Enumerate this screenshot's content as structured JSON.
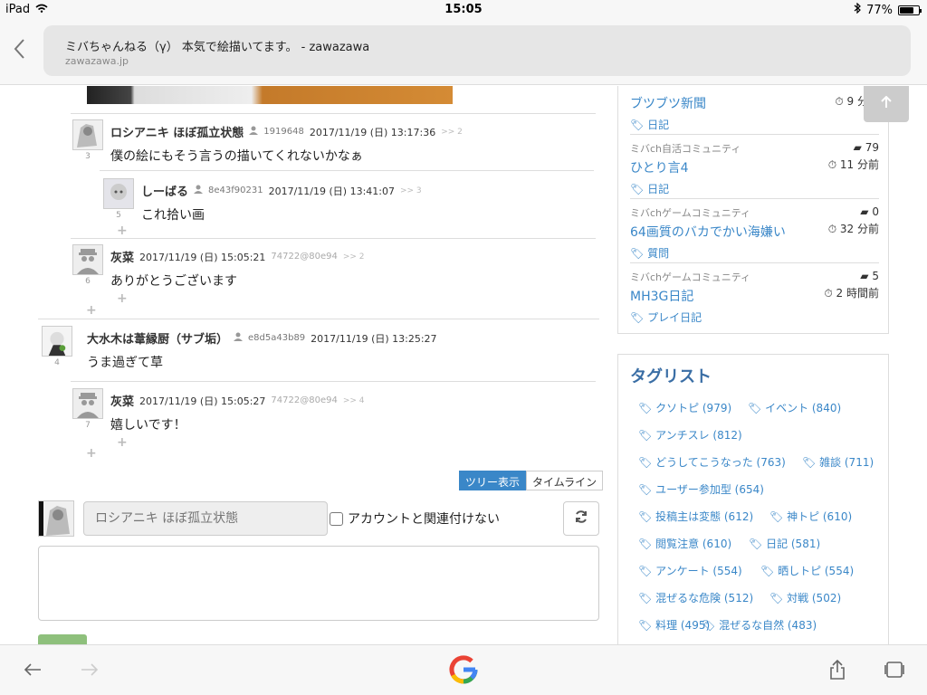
{
  "status": {
    "device": "iPad",
    "time": "15:05",
    "battery": "77%",
    "battery_level": 0.77
  },
  "browser": {
    "title": "ミバちゃんねる（γ） 本気で絵描いてます。 - zawazawa",
    "domain": "zawazawa.jp"
  },
  "comments": [
    {
      "name": "ロシアニキ ほぼ孤立状態",
      "uid": "1919648",
      "date": "2017/11/19 (日) 13:17:36",
      "reply": ">> 2",
      "num": "3",
      "body": "僕の絵にもそう言うの描いてくれないかなぁ"
    },
    {
      "name": "しーばる",
      "uid": "8e43f90231",
      "date": "2017/11/19 (日) 13:41:07",
      "reply": ">> 3",
      "num": "5",
      "body": "これ拾い画"
    },
    {
      "name": "灰菜",
      "uid": "74722@80e94",
      "date": "2017/11/19 (日) 15:05:21",
      "reply": ">> 2",
      "num": "6",
      "body": "ありがとうございます"
    },
    {
      "name": "大水木は葦縁厨（サブ垢）",
      "uid": "e8d5a43b89",
      "date": "2017/11/19 (日) 13:25:27",
      "reply": "",
      "num": "4",
      "body": "うま過ぎて草"
    },
    {
      "name": "灰菜",
      "uid": "74722@80e94",
      "date": "2017/11/19 (日) 15:05:27",
      "reply": ">> 4",
      "num": "7",
      "body": "嬉しいです！"
    }
  ],
  "plus": "+",
  "view": {
    "tree": "ツリー表示",
    "timeline": "タイムライン"
  },
  "form": {
    "name_placeholder": "ロシアニキ ほぼ孤立状態",
    "checkbox_label": "アカウントと関連付けない"
  },
  "trending": [
    {
      "category": "",
      "title": "ブツブツ新聞",
      "tag": "日記",
      "count": "",
      "age": "9 分前"
    },
    {
      "category": "ミバch自活コミュニティ",
      "title": "ひとり言4",
      "tag": "日記",
      "count": "79",
      "age": "11 分前"
    },
    {
      "category": "ミバchゲームコミュニティ",
      "title": "64画質のバカでかい海嫌い",
      "tag": "質問",
      "count": "0",
      "age": "32 分前"
    },
    {
      "category": "ミバchゲームコミュニティ",
      "title": "MH3G日記",
      "tag": "プレイ日記",
      "count": "5",
      "age": "2 時間前"
    }
  ],
  "taglist": {
    "heading": "タグリスト",
    "items": [
      "クソトピ (979)",
      "イベント (840)",
      "アンチスレ (812)",
      "どうしてこうなった (763)",
      "雑談 (711)",
      "ユーザー参加型 (654)",
      "投稿主は変態 (612)",
      "神トピ (610)",
      "閲覧注意 (610)",
      "日記 (581)",
      "アンケート (554)",
      "晒しトピ (554)",
      "混ぜるな危険 (512)",
      "対戦 (502)",
      "料理 (495)",
      "混ぜるな自然 (483)"
    ]
  },
  "colors": {
    "accent": "#3a87c8",
    "heading": "#3a6ea5"
  }
}
